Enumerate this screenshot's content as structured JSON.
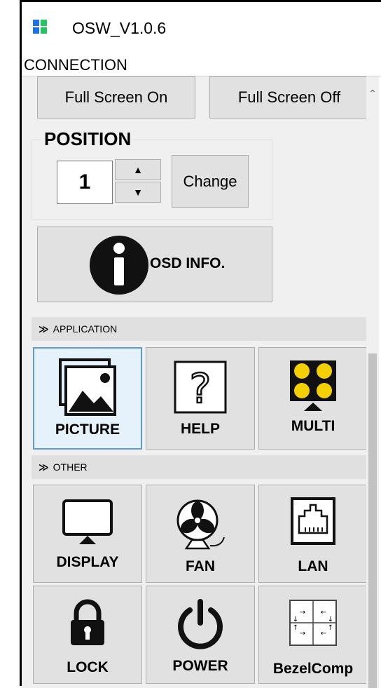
{
  "window": {
    "title": "OSW_V1.0.6"
  },
  "menubar": {
    "items": [
      "CONNECTION"
    ]
  },
  "top_buttons": {
    "full_on": "Full Screen On",
    "full_off": "Full Screen Off"
  },
  "position": {
    "title": "POSITION",
    "value": "1",
    "change_label": "Change",
    "up": "▲",
    "down": "▼"
  },
  "osd_info": {
    "label": "OSD INFO."
  },
  "sections": {
    "application": {
      "title": "APPLICATION",
      "chevron": "≫"
    },
    "other": {
      "title": "OTHER",
      "chevron": "≫"
    }
  },
  "application_tiles": [
    {
      "label": "PICTURE",
      "icon": "picture-icon",
      "selected": true
    },
    {
      "label": "HELP",
      "icon": "help-icon",
      "selected": false
    },
    {
      "label": "MULTI",
      "icon": "multi-display-icon",
      "selected": false
    }
  ],
  "other_tiles": [
    {
      "label": "DISPLAY",
      "icon": "monitor-icon"
    },
    {
      "label": "FAN",
      "icon": "fan-icon"
    },
    {
      "label": "LAN",
      "icon": "ethernet-port-icon"
    },
    {
      "label": "LOCK",
      "icon": "lock-icon"
    },
    {
      "label": "POWER",
      "icon": "power-icon"
    },
    {
      "label": "BezelComp",
      "icon": "bezel-compensation-icon"
    }
  ],
  "colors": {
    "logo_blue": "#1a73e8",
    "logo_green": "#22c55e",
    "selected_bg": "#e5f1fb",
    "selected_border": "#5a9bd8",
    "multi_face": "#f5d000"
  }
}
